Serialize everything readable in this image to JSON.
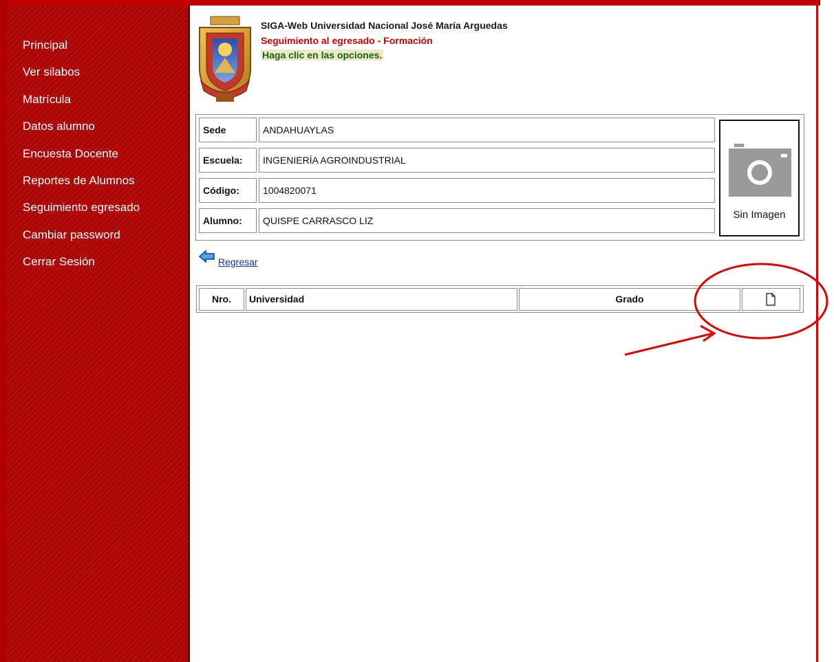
{
  "sidebar": {
    "items": [
      {
        "label": "Principal"
      },
      {
        "label": "Ver silabos"
      },
      {
        "label": "Matrícula"
      },
      {
        "label": "Datos alumno"
      },
      {
        "label": "Encuesta Docente"
      },
      {
        "label": "Reportes de Alumnos"
      },
      {
        "label": "Seguimiento egresado"
      },
      {
        "label": "Cambiar password"
      },
      {
        "label": "Cerrar Sesión"
      }
    ]
  },
  "header": {
    "system_title": "SIGA-Web Universidad Nacional José María Arguedas",
    "section_title": "Seguimiento al egresado - Formación",
    "instruction": "Haga clic en las opciones."
  },
  "student": {
    "fields": [
      {
        "label": "Sede",
        "value": "ANDAHUAYLAS"
      },
      {
        "label": "Escuela:",
        "value": "INGENIERÍA AGROINDUSTRIAL"
      },
      {
        "label": "Código:",
        "value": "1004820071"
      },
      {
        "label": "Alumno:",
        "value": "QUISPE CARRASCO LIZ"
      }
    ],
    "photo_caption": "Sin Imagen"
  },
  "nav": {
    "back_label": "Regresar"
  },
  "grid": {
    "columns": [
      "Nro.",
      "Universidad",
      "Grado"
    ],
    "action_icon": "new-document-icon"
  },
  "colors": {
    "sidebar_bg": "#b30000",
    "section_title": "#cc0000",
    "instruction": "#116611",
    "annotation": "#e00000"
  }
}
